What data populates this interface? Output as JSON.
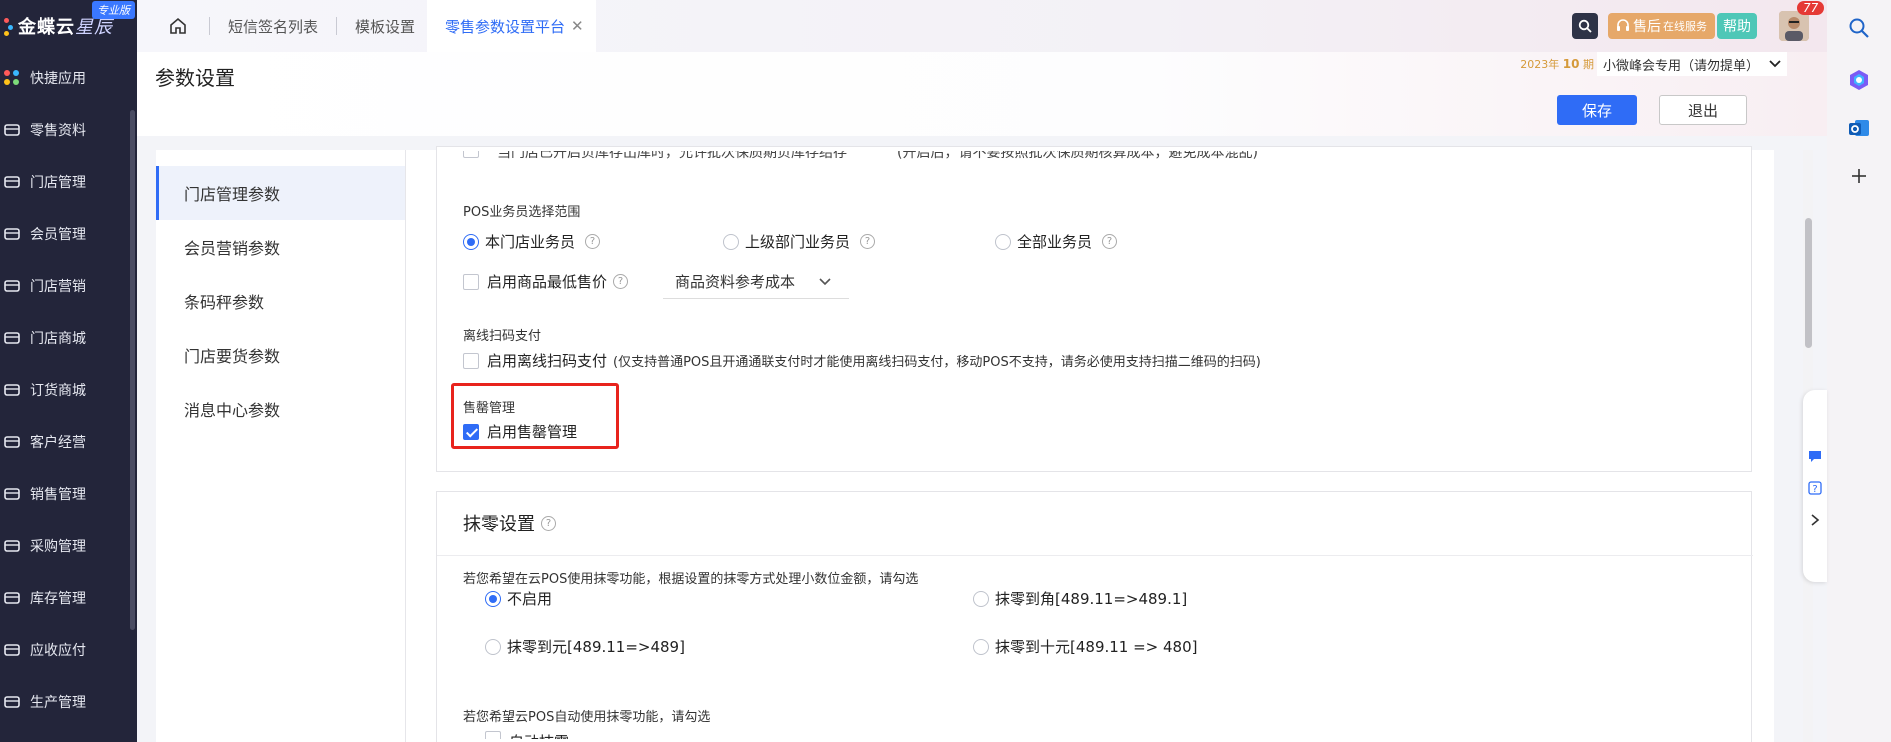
{
  "sidebar": {
    "brand": "金蝶云",
    "brand_suffix": "星辰",
    "edition": "专业版",
    "items": [
      {
        "label": "快捷应用",
        "icon": "apps-grid-icon"
      },
      {
        "label": "零售资料",
        "icon": "basket-icon"
      },
      {
        "label": "门店管理",
        "icon": "store-icon"
      },
      {
        "label": "会员管理",
        "icon": "member-heart-icon"
      },
      {
        "label": "门店营销",
        "icon": "marketing-icon"
      },
      {
        "label": "门店商城",
        "icon": "mall-icon"
      },
      {
        "label": "订货商城",
        "icon": "order-mall-icon"
      },
      {
        "label": "客户经营",
        "icon": "customer-icon"
      },
      {
        "label": "销售管理",
        "icon": "sales-chart-icon"
      },
      {
        "label": "采购管理",
        "icon": "truck-icon"
      },
      {
        "label": "库存管理",
        "icon": "box-icon"
      },
      {
        "label": "应收应付",
        "icon": "finance-icon"
      },
      {
        "label": "生产管理",
        "icon": "factory-icon"
      }
    ]
  },
  "tabs": [
    {
      "label": "短信签名列表"
    },
    {
      "label": "模板设置"
    },
    {
      "label": "零售参数设置平台",
      "active": true
    }
  ],
  "header": {
    "service_label": "售后",
    "service_small": "在线服务",
    "help_label": "帮助",
    "notification_count": "77"
  },
  "page": {
    "title": "参数设置",
    "period_year": "2023年",
    "period_num": "10",
    "period_unit": "期",
    "org": "小微峰会专用（请勿提单）",
    "save_label": "保存",
    "exit_label": "退出"
  },
  "left_menu": [
    {
      "label": "门店管理参数",
      "active": true
    },
    {
      "label": "会员营销参数"
    },
    {
      "label": "条码秤参数"
    },
    {
      "label": "门店要货参数"
    },
    {
      "label": "消息中心参数"
    }
  ],
  "section1": {
    "clipped_left": "当门店已开启负库存出库时，允许批次保质期负库存结存",
    "clipped_right": "(开启后，请不要按照批次保质期核算成本，避免成本混乱)",
    "pos_scope_label": "POS业务员选择范围",
    "pos_scope_options": [
      "本门店业务员",
      "上级部门业务员",
      "全部业务员"
    ],
    "min_price_label": "启用商品最低售价",
    "min_price_select": "商品资料参考成本",
    "offline_label": "离线扫码支付",
    "offline_check": "启用离线扫码支付",
    "offline_note": "(仅支持普通POS且开通通联支付时才能使用离线扫码支付，移动POS不支持，请务必使用支持扫描二维码的扫码)",
    "soldout_label": "售罄管理",
    "soldout_check": "启用售罄管理"
  },
  "section2": {
    "title": "抹零设置",
    "desc1": "若您希望在云POS使用抹零功能，根据设置的抹零方式处理小数位金额，请勾选",
    "options": [
      "不启用",
      "抹零到角[489.11=>489.1]",
      "抹零到元[489.11=>489]",
      "抹零到十元[489.11 => 480]"
    ],
    "desc2": "若您希望云POS自动使用抹零功能，请勾选",
    "auto_check": "自动抹零"
  },
  "colors": {
    "accent": "#2f6cf6",
    "sidebar_bg": "#23253a",
    "highlight": "#e8231d"
  }
}
